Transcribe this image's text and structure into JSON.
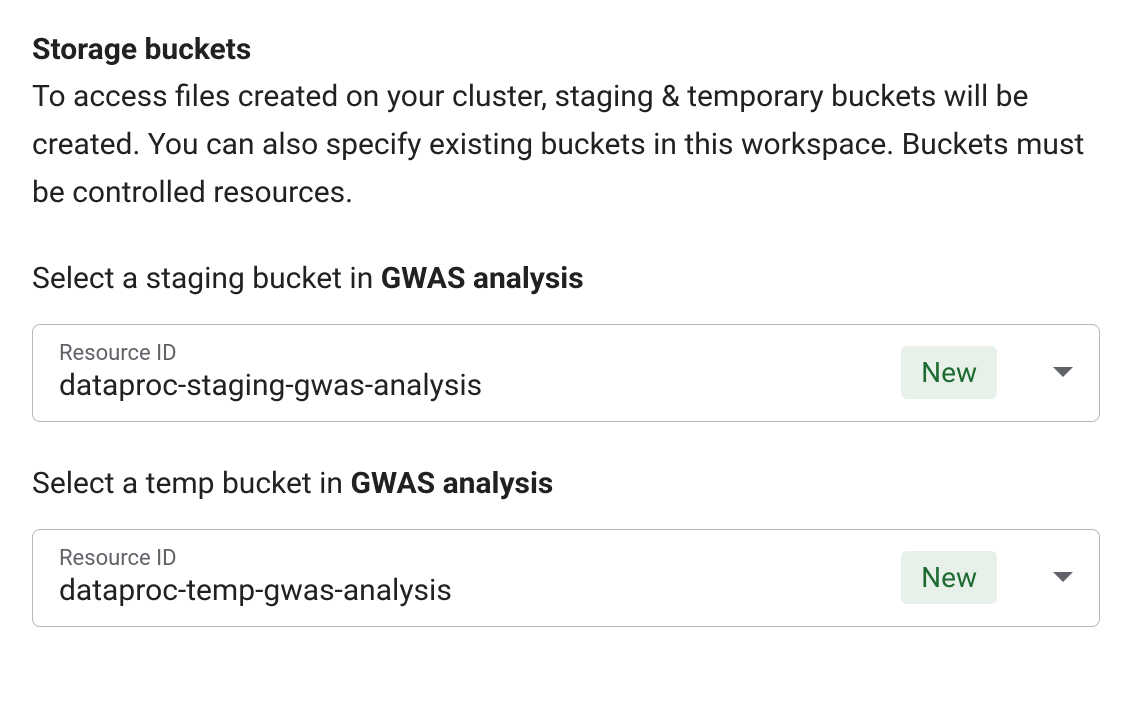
{
  "section": {
    "title": "Storage buckets",
    "description": "To access files created on your cluster, staging & temporary buckets will be created. You can also specify existing buckets in this workspace. Buckets must be controlled resources."
  },
  "workspace_name": "GWAS analysis",
  "staging": {
    "label_prefix": "Select a staging bucket in ",
    "resource_id_label": "Resource ID",
    "value": "dataproc-staging-gwas-analysis",
    "badge": "New"
  },
  "temp": {
    "label_prefix": "Select a temp bucket in ",
    "resource_id_label": "Resource ID",
    "value": "dataproc-temp-gwas-analysis",
    "badge": "New"
  }
}
